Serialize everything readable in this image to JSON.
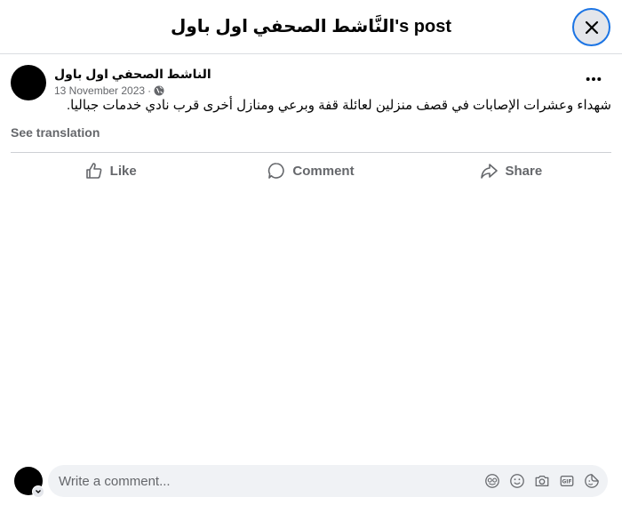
{
  "header": {
    "title": "النَّاشط الصحفي اول باول's post",
    "close_icon": "close-icon"
  },
  "post": {
    "author": "الناشط الصحفي اول باول",
    "date": "13 November 2023",
    "separator": "·",
    "privacy_icon": "globe-icon",
    "more_icon": "more-icon",
    "text": "شهداء وعشرات الإصابات في قصف منزلين لعائلة قفة وبرعي ومنازل أخرى قرب نادي خدمات جباليا.",
    "see_translation": "See translation"
  },
  "actions": [
    {
      "label": "Like",
      "icon": "like-icon"
    },
    {
      "label": "Comment",
      "icon": "comment-icon"
    },
    {
      "label": "Share",
      "icon": "share-icon"
    }
  ],
  "comment_box": {
    "placeholder": "Write a comment...",
    "icons": [
      "avatar-sticker-icon",
      "emoji-icon",
      "camera-icon",
      "gif-icon",
      "sticker-icon"
    ]
  },
  "colors": {
    "accent": "#1b74e4",
    "secondary_text": "#65676b",
    "input_bg": "#f0f2f5"
  }
}
